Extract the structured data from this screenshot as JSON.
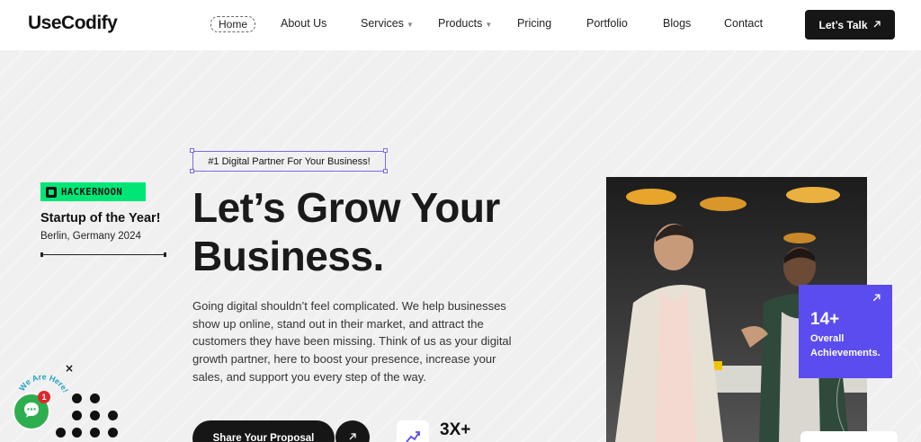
{
  "brand": {
    "logo_text": "UseCodify"
  },
  "nav": {
    "items": [
      {
        "label": "Home",
        "active": true
      },
      {
        "label": "About Us"
      },
      {
        "label": "Services",
        "has_dropdown": true
      },
      {
        "label": "Products",
        "has_dropdown": true
      },
      {
        "label": "Pricing"
      },
      {
        "label": "Portfolio"
      },
      {
        "label": "Blogs"
      },
      {
        "label": "Contact"
      }
    ],
    "cta_label": "Let’s Talk",
    "cta_icon": "arrow-up-right-icon"
  },
  "award": {
    "badge_text": "HACKERNOON",
    "title": "Startup of the Year!",
    "subtitle": "Berlin, Germany 2024"
  },
  "hero": {
    "tagline": "#1 Digital Partner For Your Business!",
    "headline_line1": "Let’s Grow Your",
    "headline_line2": "Business.",
    "description": "Going digital shouldn’t feel complicated. We help businesses show up online, stand out in their market, and attract the customers they have been missing. Think of us as your digital growth partner, here to boost your presence, increase your sales, and support you every step of the way.",
    "primary_button": "Share Your Proposal",
    "stat_value": "3X+"
  },
  "achievement": {
    "value": "14+",
    "label_line1": "Overall",
    "label_line2": "Achievements."
  },
  "chat_widget": {
    "label": "We Are Here!",
    "badge_count": "1",
    "close_label": "×"
  },
  "colors": {
    "accent_purple": "#5b4cf0",
    "hackernoon_green": "#00e676",
    "chat_green": "#2eae4f",
    "badge_red": "#e0262a"
  }
}
